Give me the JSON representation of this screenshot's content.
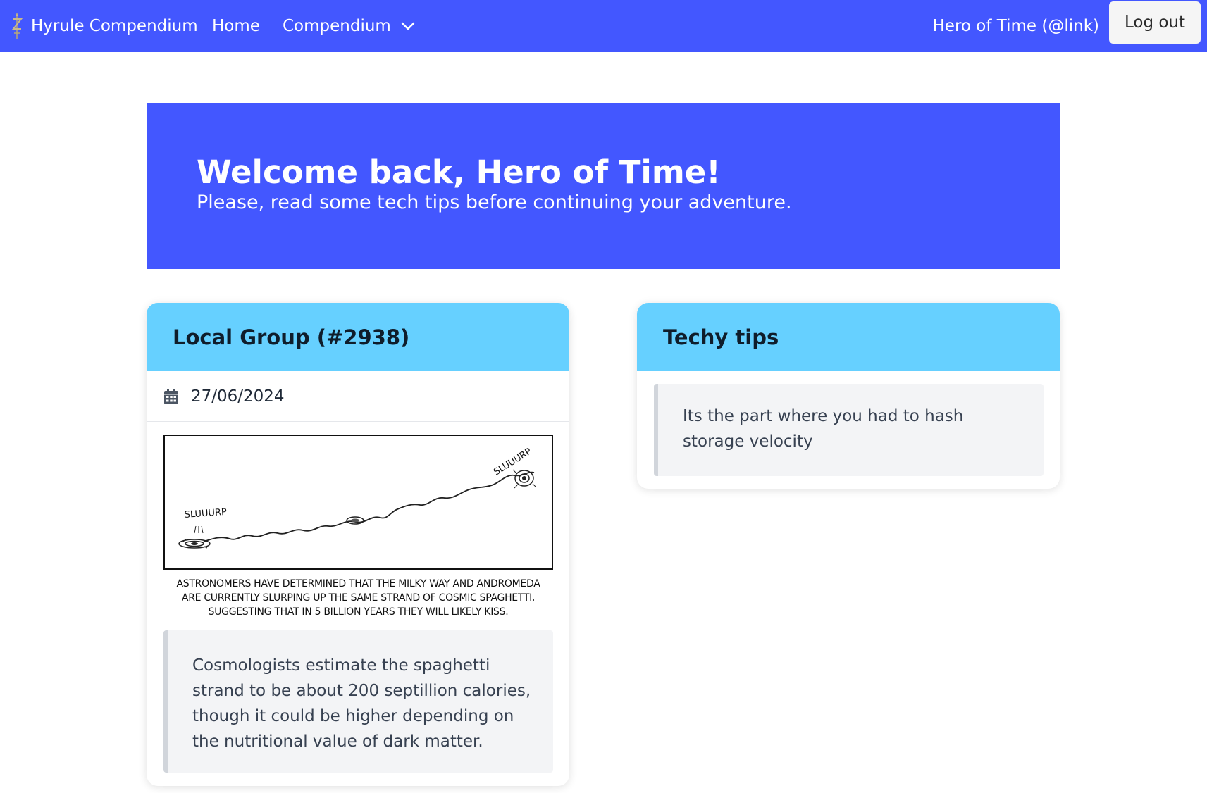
{
  "nav": {
    "brand": "Hyrule Compendium",
    "brand_icon": "triforce-sword-logo-icon",
    "home": "Home",
    "compendium": "Compendium",
    "user": "Hero of Time (@link)",
    "logout": "Log out"
  },
  "hero": {
    "title": "Welcome back, Hero of Time!",
    "subtitle": "Please, read some tech tips before continuing your adventure."
  },
  "cards": {
    "left": {
      "title": "Local Group (#2938)",
      "date": "27/06/2024",
      "comic": {
        "word_left": "SLUUURP",
        "word_right": "SLUUURP",
        "caption_lines": [
          "ASTRONOMERS HAVE DETERMINED THAT THE MILKY WAY AND ANDROMEDA",
          "ARE CURRENTLY SLURPING UP THE SAME STRAND OF COSMIC SPAGHETTI,",
          "SUGGESTING THAT IN 5 BILLION YEARS THEY WILL LIKELY KISS."
        ]
      },
      "quote": "Cosmologists estimate the spaghetti strand to be about 200 septillion calories, though it could be higher depending on the nutritional value of dark matter."
    },
    "right": {
      "title": "Techy tips",
      "quote": "Its the part where you had to hash storage velocity"
    }
  },
  "colors": {
    "primary": "#4357ff",
    "card_header": "#66d0ff",
    "quote_bg": "#f3f4f6"
  }
}
